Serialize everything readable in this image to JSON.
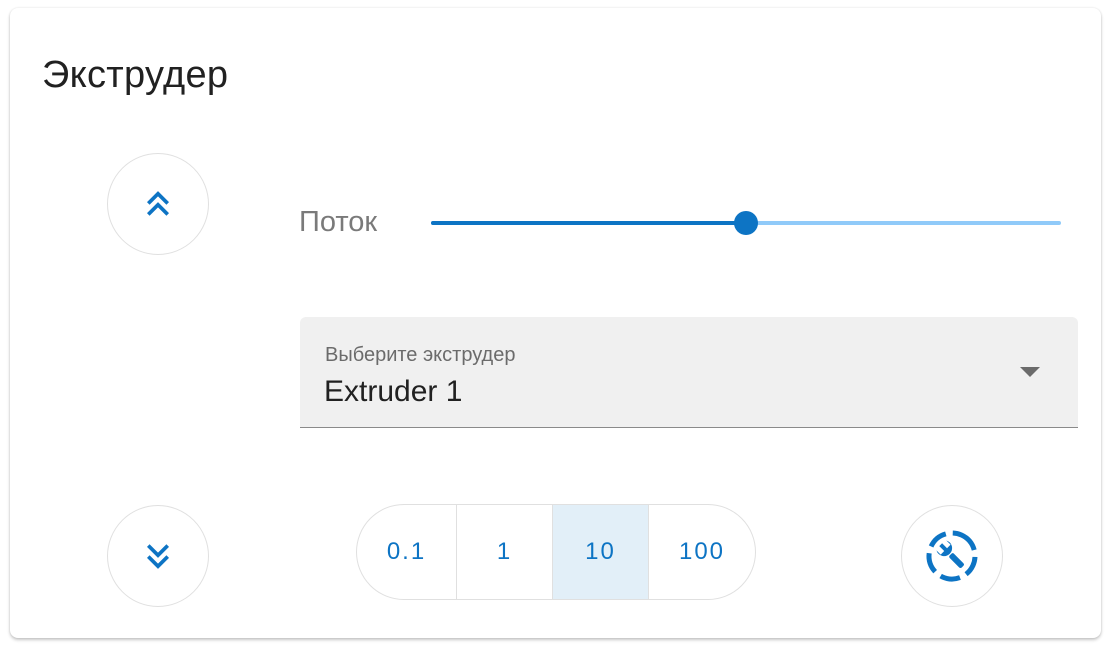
{
  "card": {
    "title": "Экструдер"
  },
  "flow": {
    "label": "Поток",
    "value_fraction": 0.5
  },
  "extruder_select": {
    "label": "Выберите экструдер",
    "value": "Extruder 1"
  },
  "steps": {
    "options": [
      "0.1",
      "1",
      "10",
      "100"
    ],
    "selected": "10"
  },
  "icons": {
    "up": "chevron-double-up-icon",
    "down": "chevron-double-down-icon",
    "tool": "wrench-dashed-circle-icon",
    "dropdown": "caret-down-icon"
  },
  "colors": {
    "accent": "#0d74c4",
    "accent_light": "#90caf9",
    "selected_bg": "#e2eff8"
  }
}
